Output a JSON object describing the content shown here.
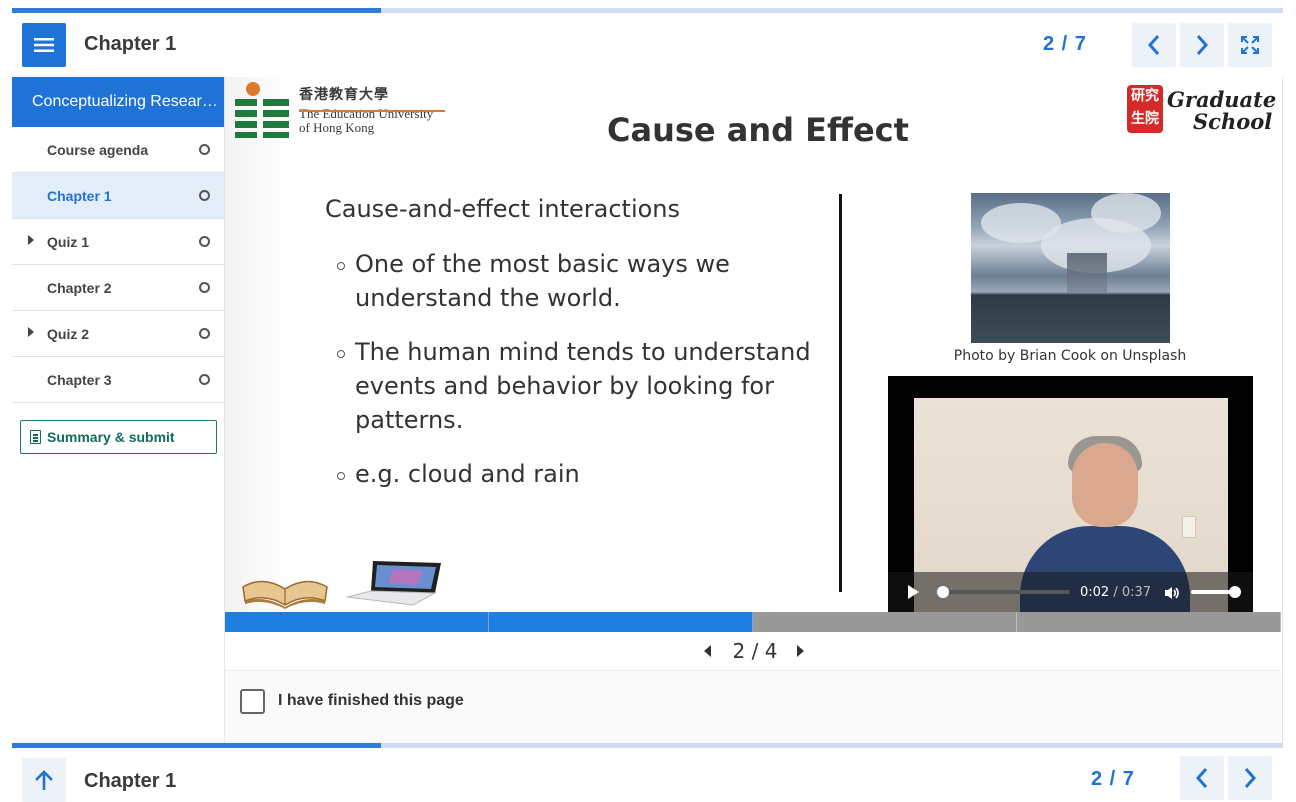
{
  "header": {
    "title": "Chapter 1",
    "page_current": "2",
    "page_total": "7",
    "pager_text": "2 / 7",
    "progress_fraction": 0.29
  },
  "sidebar": {
    "course_title": "Conceptualizing Resear…",
    "items": [
      {
        "label": "Course agenda",
        "expandable": false,
        "active": false
      },
      {
        "label": "Chapter 1",
        "expandable": false,
        "active": true
      },
      {
        "label": "Quiz 1",
        "expandable": true,
        "active": false
      },
      {
        "label": "Chapter 2",
        "expandable": false,
        "active": false
      },
      {
        "label": "Quiz 2",
        "expandable": true,
        "active": false
      },
      {
        "label": "Chapter 3",
        "expandable": false,
        "active": false
      }
    ],
    "summary_label": "Summary & submit"
  },
  "slide": {
    "logo_zh": "香港教育大學",
    "logo_en_1": "The Education University",
    "logo_en_2": "of Hong Kong",
    "grad_seal": "研究生院",
    "grad_line1": "Graduate",
    "grad_line2": "School",
    "title": "Cause and Effect",
    "lead": "Cause-and-effect interactions",
    "bullets": [
      "One of the most basic ways we understand the world.",
      "The human mind tends to understand events and behavior by looking for patterns.",
      "e.g. cloud and rain"
    ],
    "photo_caption": "Photo by Brian Cook on Unsplash",
    "video": {
      "current_time": "0:02",
      "duration": "0:37",
      "separator": "/",
      "played_fraction": 0.05,
      "volume_fraction": 1.0
    }
  },
  "slide_pager": {
    "current": 2,
    "total": 4,
    "text": "2 / 4"
  },
  "finish": {
    "label": "I have finished this page",
    "checked": false
  },
  "footer": {
    "title": "Chapter 1",
    "pager_text": "2 / 7"
  },
  "colors": {
    "primary": "#1f73d6",
    "summary": "#136b5c",
    "progress_done": "#1f7ee0",
    "progress_todo": "#999999"
  },
  "icons": [
    "menu-icon",
    "chevron-left-icon",
    "chevron-right-icon",
    "fullscreen-icon",
    "caret-right-icon",
    "status-circle-icon",
    "document-icon",
    "play-icon",
    "volume-icon",
    "arrow-up-icon"
  ]
}
